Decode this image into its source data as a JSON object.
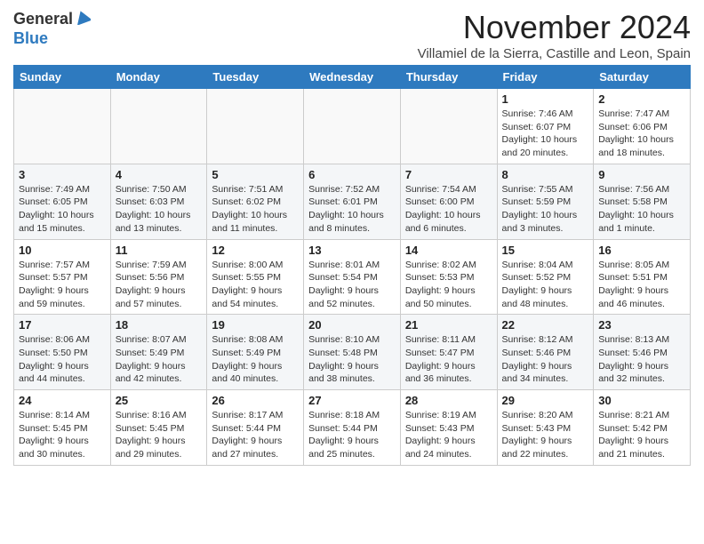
{
  "header": {
    "logo_general": "General",
    "logo_blue": "Blue",
    "month": "November 2024",
    "location": "Villamiel de la Sierra, Castille and Leon, Spain"
  },
  "columns": [
    "Sunday",
    "Monday",
    "Tuesday",
    "Wednesday",
    "Thursday",
    "Friday",
    "Saturday"
  ],
  "weeks": [
    [
      {
        "day": "",
        "content": ""
      },
      {
        "day": "",
        "content": ""
      },
      {
        "day": "",
        "content": ""
      },
      {
        "day": "",
        "content": ""
      },
      {
        "day": "",
        "content": ""
      },
      {
        "day": "1",
        "content": "Sunrise: 7:46 AM\nSunset: 6:07 PM\nDaylight: 10 hours\nand 20 minutes."
      },
      {
        "day": "2",
        "content": "Sunrise: 7:47 AM\nSunset: 6:06 PM\nDaylight: 10 hours\nand 18 minutes."
      }
    ],
    [
      {
        "day": "3",
        "content": "Sunrise: 7:49 AM\nSunset: 6:05 PM\nDaylight: 10 hours\nand 15 minutes."
      },
      {
        "day": "4",
        "content": "Sunrise: 7:50 AM\nSunset: 6:03 PM\nDaylight: 10 hours\nand 13 minutes."
      },
      {
        "day": "5",
        "content": "Sunrise: 7:51 AM\nSunset: 6:02 PM\nDaylight: 10 hours\nand 11 minutes."
      },
      {
        "day": "6",
        "content": "Sunrise: 7:52 AM\nSunset: 6:01 PM\nDaylight: 10 hours\nand 8 minutes."
      },
      {
        "day": "7",
        "content": "Sunrise: 7:54 AM\nSunset: 6:00 PM\nDaylight: 10 hours\nand 6 minutes."
      },
      {
        "day": "8",
        "content": "Sunrise: 7:55 AM\nSunset: 5:59 PM\nDaylight: 10 hours\nand 3 minutes."
      },
      {
        "day": "9",
        "content": "Sunrise: 7:56 AM\nSunset: 5:58 PM\nDaylight: 10 hours\nand 1 minute."
      }
    ],
    [
      {
        "day": "10",
        "content": "Sunrise: 7:57 AM\nSunset: 5:57 PM\nDaylight: 9 hours\nand 59 minutes."
      },
      {
        "day": "11",
        "content": "Sunrise: 7:59 AM\nSunset: 5:56 PM\nDaylight: 9 hours\nand 57 minutes."
      },
      {
        "day": "12",
        "content": "Sunrise: 8:00 AM\nSunset: 5:55 PM\nDaylight: 9 hours\nand 54 minutes."
      },
      {
        "day": "13",
        "content": "Sunrise: 8:01 AM\nSunset: 5:54 PM\nDaylight: 9 hours\nand 52 minutes."
      },
      {
        "day": "14",
        "content": "Sunrise: 8:02 AM\nSunset: 5:53 PM\nDaylight: 9 hours\nand 50 minutes."
      },
      {
        "day": "15",
        "content": "Sunrise: 8:04 AM\nSunset: 5:52 PM\nDaylight: 9 hours\nand 48 minutes."
      },
      {
        "day": "16",
        "content": "Sunrise: 8:05 AM\nSunset: 5:51 PM\nDaylight: 9 hours\nand 46 minutes."
      }
    ],
    [
      {
        "day": "17",
        "content": "Sunrise: 8:06 AM\nSunset: 5:50 PM\nDaylight: 9 hours\nand 44 minutes."
      },
      {
        "day": "18",
        "content": "Sunrise: 8:07 AM\nSunset: 5:49 PM\nDaylight: 9 hours\nand 42 minutes."
      },
      {
        "day": "19",
        "content": "Sunrise: 8:08 AM\nSunset: 5:49 PM\nDaylight: 9 hours\nand 40 minutes."
      },
      {
        "day": "20",
        "content": "Sunrise: 8:10 AM\nSunset: 5:48 PM\nDaylight: 9 hours\nand 38 minutes."
      },
      {
        "day": "21",
        "content": "Sunrise: 8:11 AM\nSunset: 5:47 PM\nDaylight: 9 hours\nand 36 minutes."
      },
      {
        "day": "22",
        "content": "Sunrise: 8:12 AM\nSunset: 5:46 PM\nDaylight: 9 hours\nand 34 minutes."
      },
      {
        "day": "23",
        "content": "Sunrise: 8:13 AM\nSunset: 5:46 PM\nDaylight: 9 hours\nand 32 minutes."
      }
    ],
    [
      {
        "day": "24",
        "content": "Sunrise: 8:14 AM\nSunset: 5:45 PM\nDaylight: 9 hours\nand 30 minutes."
      },
      {
        "day": "25",
        "content": "Sunrise: 8:16 AM\nSunset: 5:45 PM\nDaylight: 9 hours\nand 29 minutes."
      },
      {
        "day": "26",
        "content": "Sunrise: 8:17 AM\nSunset: 5:44 PM\nDaylight: 9 hours\nand 27 minutes."
      },
      {
        "day": "27",
        "content": "Sunrise: 8:18 AM\nSunset: 5:44 PM\nDaylight: 9 hours\nand 25 minutes."
      },
      {
        "day": "28",
        "content": "Sunrise: 8:19 AM\nSunset: 5:43 PM\nDaylight: 9 hours\nand 24 minutes."
      },
      {
        "day": "29",
        "content": "Sunrise: 8:20 AM\nSunset: 5:43 PM\nDaylight: 9 hours\nand 22 minutes."
      },
      {
        "day": "30",
        "content": "Sunrise: 8:21 AM\nSunset: 5:42 PM\nDaylight: 9 hours\nand 21 minutes."
      }
    ]
  ]
}
